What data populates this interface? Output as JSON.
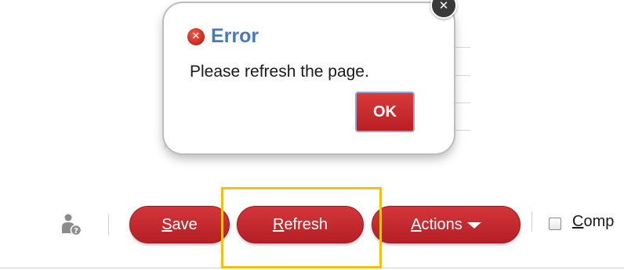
{
  "dialog": {
    "title": "Error",
    "message": "Please refresh the page.",
    "ok_label": "OK",
    "close_icon": "close-icon",
    "error_icon": "error-icon"
  },
  "toolbar": {
    "user_icon": "user-help-icon",
    "save_label": {
      "mnemonic": "S",
      "rest": "ave"
    },
    "refresh_label": {
      "mnemonic": "R",
      "rest": "efresh"
    },
    "actions_label": {
      "mnemonic": "A",
      "rest": "ctions"
    },
    "checkbox_label": {
      "mnemonic": "C",
      "rest": "omp"
    },
    "checkbox_checked": false
  },
  "colors": {
    "button_red": "#c0282c",
    "dialog_title": "#4a7ab5",
    "highlight": "#f6bd13"
  }
}
